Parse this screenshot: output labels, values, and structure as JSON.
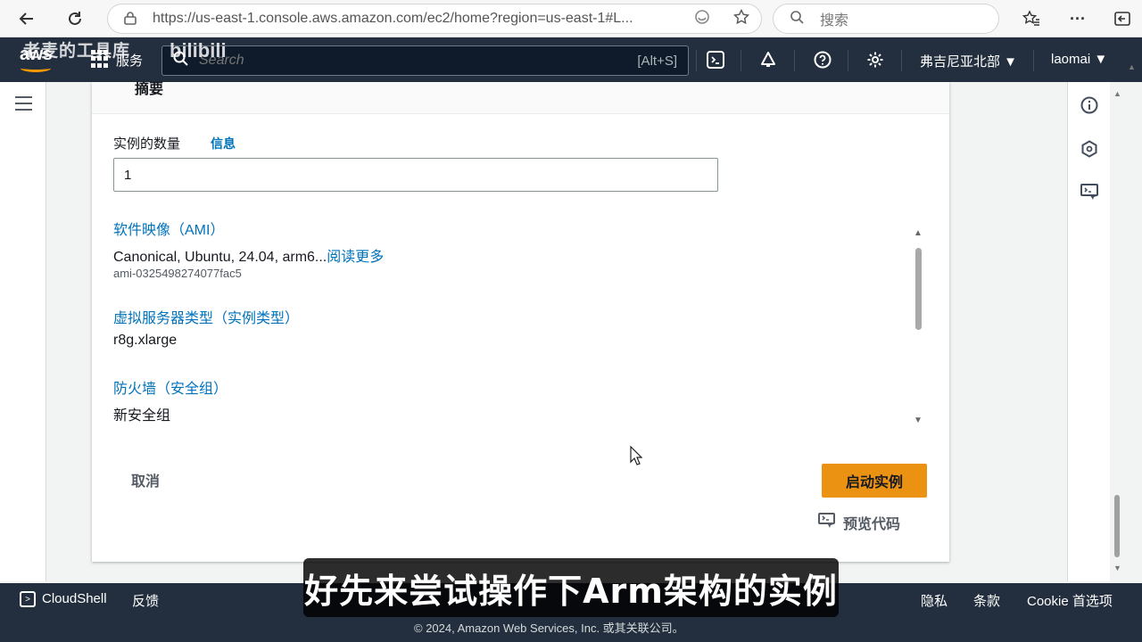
{
  "browser": {
    "url": "https://us-east-1.console.aws.amazon.com/ec2/home?region=us-east-1#L...",
    "search_placeholder": "搜索",
    "icons": [
      "back-icon",
      "refresh-icon",
      "lock-icon",
      "edge-icon",
      "star-icon",
      "favorites-icon",
      "more-icon",
      "exit-icon"
    ]
  },
  "watermark": {
    "text": "老麦的工具库",
    "brand": "bilibili"
  },
  "aws_nav": {
    "logo": "aws",
    "services_label": "服务",
    "search_placeholder": "Search",
    "search_shortcut": "[Alt+S]",
    "region": "弗吉尼亚北部 ▼",
    "user": "laomai ▼",
    "icons": [
      "cloudshell-icon",
      "bell-icon",
      "help-icon",
      "settings-icon"
    ]
  },
  "panel": {
    "header_text": "摘要",
    "instance_count_label": "实例的数量",
    "info_link": "信息",
    "instance_count_value": "1",
    "ami_label": "软件映像（AMI）",
    "ami_value": "Canonical, Ubuntu, 24.04, arm6...",
    "ami_read_more": "阅读更多",
    "ami_id": "ami-0325498274077fac5",
    "instance_type_label": "虚拟服务器类型（实例类型）",
    "instance_type_value": "r8g.xlarge",
    "firewall_label": "防火墙（安全组）",
    "firewall_value": "新安全组",
    "cancel_label": "取消",
    "launch_label": "启动实例",
    "preview_label": "预览代码"
  },
  "footer": {
    "cloudshell": "CloudShell",
    "feedback": "反馈",
    "privacy": "隐私",
    "terms": "条款",
    "cookie": "Cookie 首选项",
    "copyright": "© 2024, Amazon Web Services, Inc. 或其关联公司。"
  },
  "subtitle": "好先来尝试操作下Arm架构的实例",
  "colors": {
    "aws_nav_bg": "#232f3e",
    "link_blue": "#0073bb",
    "launch_orange": "#ec9213"
  }
}
